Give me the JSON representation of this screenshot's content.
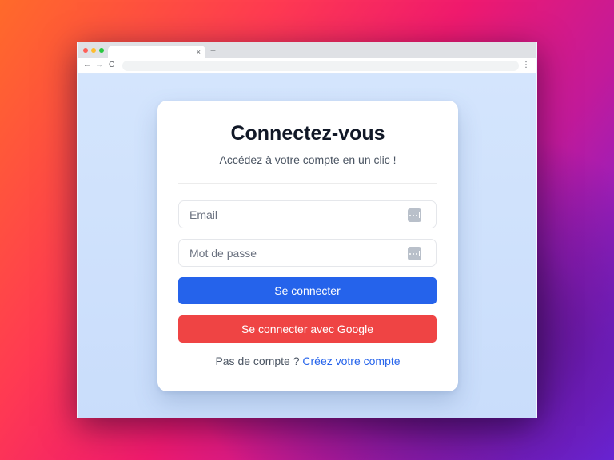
{
  "browser": {
    "tab_close": "×",
    "new_tab": "+",
    "nav_back": "←",
    "nav_forward": "→",
    "nav_reload": "C",
    "menu": "⋮",
    "omnibox_value": ""
  },
  "login": {
    "title": "Connectez-vous",
    "subtitle": "Accédez à votre compte en un clic !",
    "email_placeholder": "Email",
    "password_placeholder": "Mot de passe",
    "submit_label": "Se connecter",
    "google_label": "Se connecter avec Google",
    "no_account_text": "Pas de compte ?",
    "create_account_link": "Créez votre compte"
  },
  "colors": {
    "primary": "#2563eb",
    "google": "#ef4444",
    "page_bg": "#d4e5fd"
  }
}
